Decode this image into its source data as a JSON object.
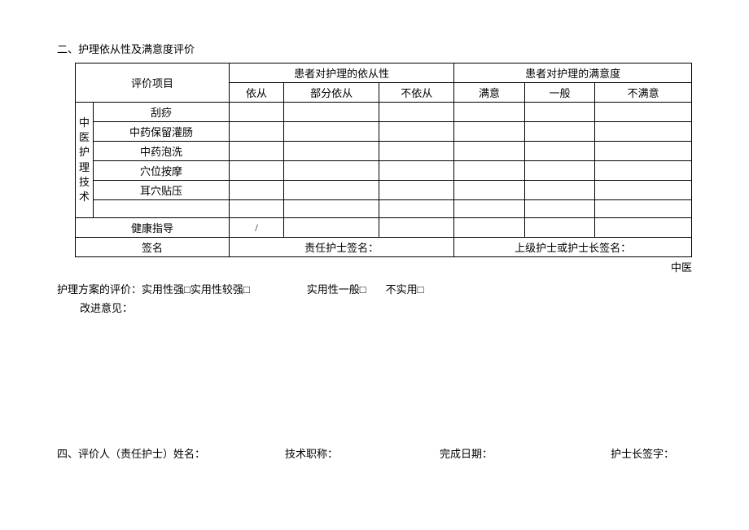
{
  "section_title": "二、护理依从性及满意度评价",
  "table": {
    "header": {
      "eval_item": "评价项目",
      "compliance_group": "患者对护理的依从性",
      "compliance_cols": [
        "依从",
        "部分依从",
        "不依从"
      ],
      "satisfaction_group": "患者对护理的满意度",
      "satisfaction_cols": [
        "满意",
        "一般",
        "不满意"
      ]
    },
    "vert_label": "中医护理技术",
    "rows": [
      "刮痧",
      "中药保留灌肠",
      "中药泡洗",
      "穴位按摩",
      "耳穴贴压",
      ""
    ],
    "health_guide_label": "健康指导",
    "health_guide_slash": "/",
    "signature_label": "签名",
    "resp_nurse_sig": "责任护士签名：",
    "senior_nurse_sig": "上级护士或护士长签名："
  },
  "trailing_text": "中医",
  "scheme_eval": {
    "prefix": "护理方案的评价：",
    "opt1": "实用性强□",
    "opt2": "实用性较强□",
    "opt3": "实用性一般□",
    "opt4": "不实用□"
  },
  "improve_label": "改进意见：",
  "footer": {
    "evaluator": "四、评价人（责任护士）姓名：",
    "title": "技术职称：",
    "date": "完成日期：",
    "head_nurse": "护士长签字："
  }
}
